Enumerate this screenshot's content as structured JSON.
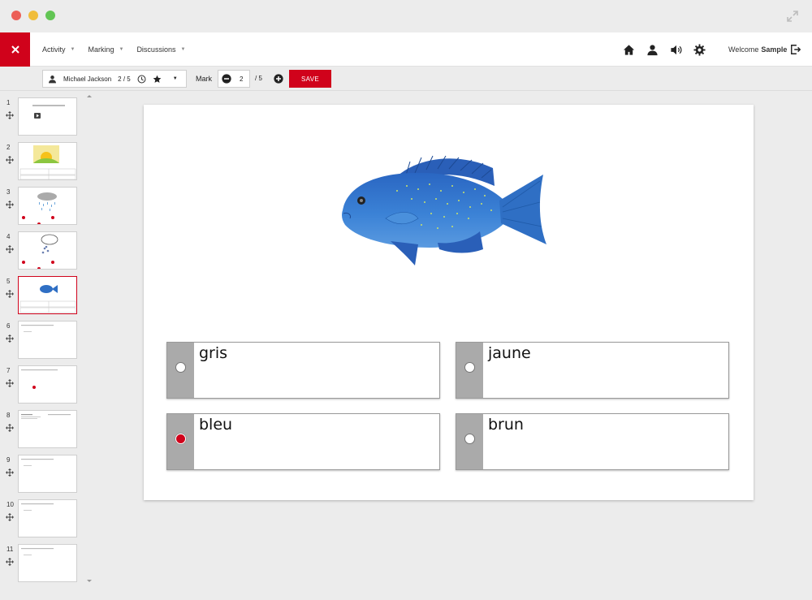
{
  "nav": {
    "menu": [
      {
        "label": "Activity"
      },
      {
        "label": "Marking"
      },
      {
        "label": "Discussions"
      }
    ],
    "welcome_label": "Welcome",
    "user_name": "Sample",
    "icons": [
      "home-icon",
      "user-icon",
      "speaker-icon",
      "gear-icon",
      "logout-icon"
    ]
  },
  "toolbar": {
    "student_name": "Michael Jackson",
    "student_progress": "2 / 5",
    "mark_label": "Mark",
    "mark_value": "2",
    "mark_total": "/ 5",
    "save_label": "SAVE"
  },
  "sidebar": {
    "slides": [
      {
        "number": "1"
      },
      {
        "number": "2"
      },
      {
        "number": "3"
      },
      {
        "number": "4"
      },
      {
        "number": "5",
        "active": true
      },
      {
        "number": "6"
      },
      {
        "number": "7"
      },
      {
        "number": "8"
      },
      {
        "number": "9"
      },
      {
        "number": "10"
      },
      {
        "number": "11"
      }
    ]
  },
  "question": {
    "options": [
      {
        "label": "gris",
        "selected": false
      },
      {
        "label": "jaune",
        "selected": false
      },
      {
        "label": "bleu",
        "selected": true
      },
      {
        "label": "brun",
        "selected": false
      }
    ]
  },
  "colors": {
    "accent": "#d0021b",
    "option_strip": "#aaaaaa",
    "fish": "#2f6fc4"
  }
}
